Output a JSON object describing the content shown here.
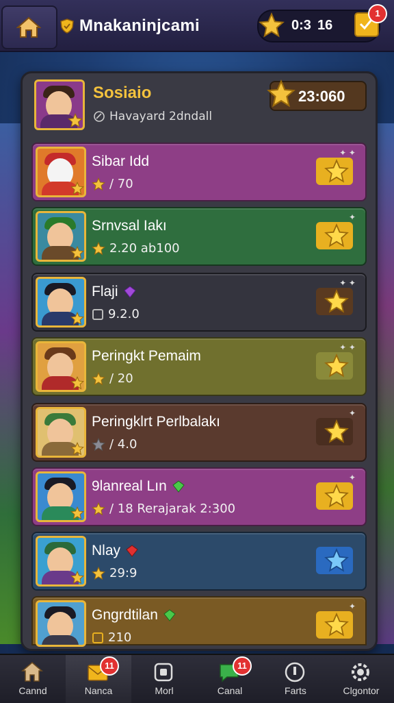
{
  "header": {
    "title": "Mnakaninjcami",
    "currency_a": "0:3",
    "currency_b": "16",
    "notification_count": "1"
  },
  "profile": {
    "name": "Sosiaio",
    "subtitle": "Havayard 2dndall",
    "score": "23:060"
  },
  "rows": [
    {
      "title": "Sibar Idd",
      "sub": "/ 70",
      "color": "#8e3e86"
    },
    {
      "title": "Srnvsal Iakı",
      "sub": "2.20 ab100",
      "color": "#2f6e3e"
    },
    {
      "title": "Flaji",
      "sub": "9.2.0",
      "color": "#34343e"
    },
    {
      "title": "Peringkt Pemaim",
      "sub": "/ 20",
      "color": "#70702e"
    },
    {
      "title": "Peringklrt Perlbalakı",
      "sub": "/ 4.0",
      "color": "#5a3a2e"
    },
    {
      "title": "9lanreal Lın",
      "sub": "/ 18 Rerajarak 2:300",
      "color": "#8e3e86"
    },
    {
      "title": "Nlay",
      "sub": "29:9",
      "color": "#2c4a6a"
    },
    {
      "title": "Gngrdtilan",
      "sub": "210",
      "color": "#7a5a24"
    }
  ],
  "nav": [
    {
      "label": "Cannd",
      "icon": "home-icon"
    },
    {
      "label": "Nanca",
      "icon": "mail-icon",
      "badge": "11"
    },
    {
      "label": "Morl",
      "icon": "box-icon"
    },
    {
      "label": "Canal",
      "icon": "chat-icon",
      "badge": "11"
    },
    {
      "label": "Farts",
      "icon": "info-icon"
    },
    {
      "label": "Clgontor",
      "icon": "settings-icon"
    }
  ],
  "colors": {
    "gold": "#f4c23d",
    "panel": "#3a3a44",
    "badge": "#e23131"
  }
}
